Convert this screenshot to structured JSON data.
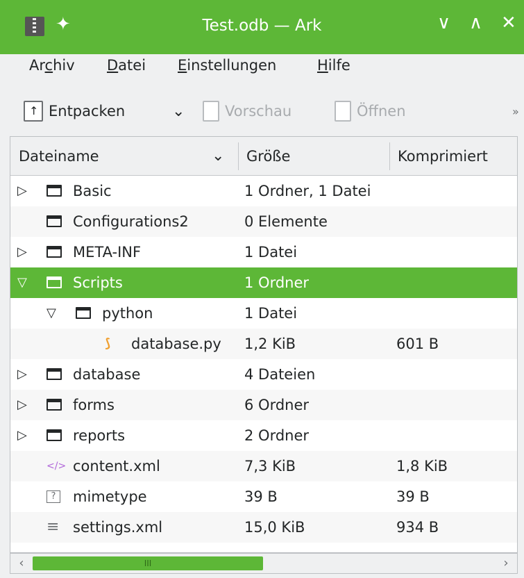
{
  "window": {
    "title": "Test.odb — Ark",
    "pin_icon": "pin-icon",
    "minimize_glyph": "∨",
    "maximize_glyph": "∧",
    "close_glyph": "✕"
  },
  "menu": {
    "items": [
      {
        "pre": "Ar",
        "key": "c",
        "post": "hiv"
      },
      {
        "pre": "",
        "key": "D",
        "post": "atei"
      },
      {
        "pre": "",
        "key": "E",
        "post": "instellungen"
      },
      {
        "pre": "",
        "key": "H",
        "post": "ilfe"
      }
    ]
  },
  "toolbar": {
    "extract_label": "Entpacken",
    "extract_dropdown": "⌄",
    "preview_label": "Vorschau",
    "open_label": "Öffnen",
    "overflow": "»"
  },
  "table": {
    "columns": [
      "Dateiname",
      "Größe",
      "Komprimiert"
    ],
    "sort_indicator": "⌄",
    "rows": [
      {
        "name": "Basic",
        "size": "1 Ordner, 1 Datei",
        "compressed": "",
        "indent": 0,
        "expander": "▷",
        "icon": "folder-icon"
      },
      {
        "name": "Configurations2",
        "size": "0 Elemente",
        "compressed": "",
        "indent": 0,
        "expander": "",
        "icon": "folder-icon"
      },
      {
        "name": "META-INF",
        "size": "1 Datei",
        "compressed": "",
        "indent": 0,
        "expander": "▷",
        "icon": "folder-icon"
      },
      {
        "name": "Scripts",
        "size": "1 Ordner",
        "compressed": "",
        "indent": 0,
        "expander": "▽",
        "icon": "folder-icon",
        "selected": true
      },
      {
        "name": "python",
        "size": "1 Datei",
        "compressed": "",
        "indent": 1,
        "expander": "▽",
        "icon": "folder-icon"
      },
      {
        "name": "database.py",
        "size": "1,2 KiB",
        "compressed": "601 B",
        "indent": 2,
        "expander": "",
        "icon": "python-icon"
      },
      {
        "name": "database",
        "size": "4 Dateien",
        "compressed": "",
        "indent": 0,
        "expander": "▷",
        "icon": "folder-icon"
      },
      {
        "name": "forms",
        "size": "6 Ordner",
        "compressed": "",
        "indent": 0,
        "expander": "▷",
        "icon": "folder-icon"
      },
      {
        "name": "reports",
        "size": "2 Ordner",
        "compressed": "",
        "indent": 0,
        "expander": "▷",
        "icon": "folder-icon"
      },
      {
        "name": "content.xml",
        "size": "7,3 KiB",
        "compressed": "1,8 KiB",
        "indent": 0,
        "expander": "",
        "icon": "xml-icon"
      },
      {
        "name": "mimetype",
        "size": "39 B",
        "compressed": "39 B",
        "indent": 0,
        "expander": "",
        "icon": "unknown-file-icon"
      },
      {
        "name": "settings.xml",
        "size": "15,0 KiB",
        "compressed": "934 B",
        "indent": 0,
        "expander": "",
        "icon": "text-file-icon"
      }
    ]
  },
  "scrollbar": {
    "left": "‹",
    "right": "›",
    "grip": "III",
    "position_fraction": 0.45
  },
  "colors": {
    "accent": "#5db737",
    "background": "#eff0f1",
    "text": "#232627"
  }
}
